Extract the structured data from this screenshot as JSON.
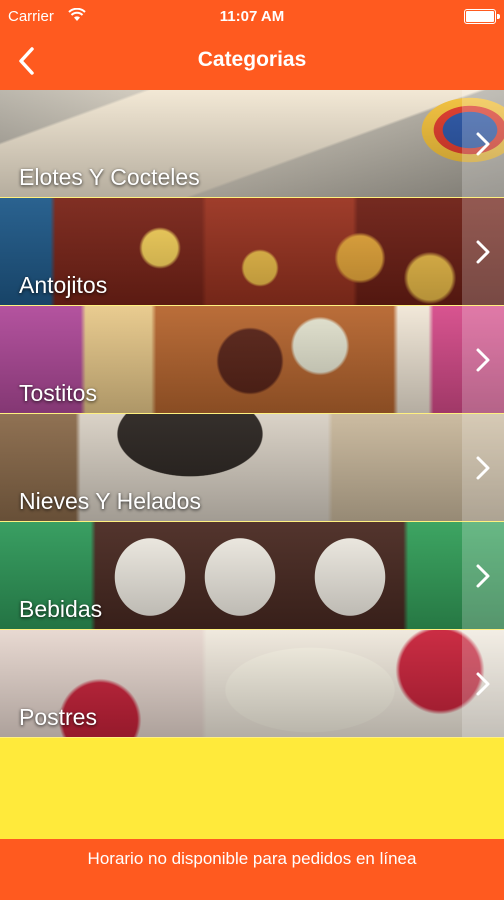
{
  "status_bar": {
    "carrier": "Carrier",
    "time": "11:07 AM",
    "wifi_icon": "wifi-icon",
    "battery_icon": "battery-icon"
  },
  "nav": {
    "title": "Categorias",
    "back_icon": "chevron-left-icon"
  },
  "categories": [
    {
      "label": "Elotes Y Cocteles",
      "chevron_icon": "chevron-right-icon"
    },
    {
      "label": "Antojitos",
      "chevron_icon": "chevron-right-icon"
    },
    {
      "label": "Tostitos",
      "chevron_icon": "chevron-right-icon"
    },
    {
      "label": "Nieves Y Helados",
      "chevron_icon": "chevron-right-icon"
    },
    {
      "label": "Bebidas",
      "chevron_icon": "chevron-right-icon"
    },
    {
      "label": "Postres",
      "chevron_icon": "chevron-right-icon"
    }
  ],
  "footer": {
    "message": "Horario no disponible para pedidos en línea"
  },
  "colors": {
    "primary": "#ff5a1f",
    "background": "#ffea3b",
    "text": "#ffffff"
  }
}
